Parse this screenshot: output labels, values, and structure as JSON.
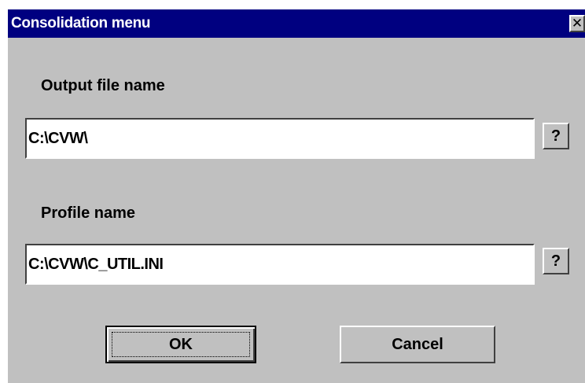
{
  "window": {
    "title": "Consolidation menu",
    "close_glyph": "✕",
    "titlebar_color": "#000080",
    "face_color": "#c0c0c0"
  },
  "output_file": {
    "label": "Output file name",
    "value": "C:\\CVW\\",
    "help_label": "?"
  },
  "profile": {
    "label": "Profile name",
    "value": "C:\\CVW\\C_UTIL.INI",
    "help_label": "?"
  },
  "buttons": {
    "ok_label": "OK",
    "cancel_label": "Cancel"
  }
}
